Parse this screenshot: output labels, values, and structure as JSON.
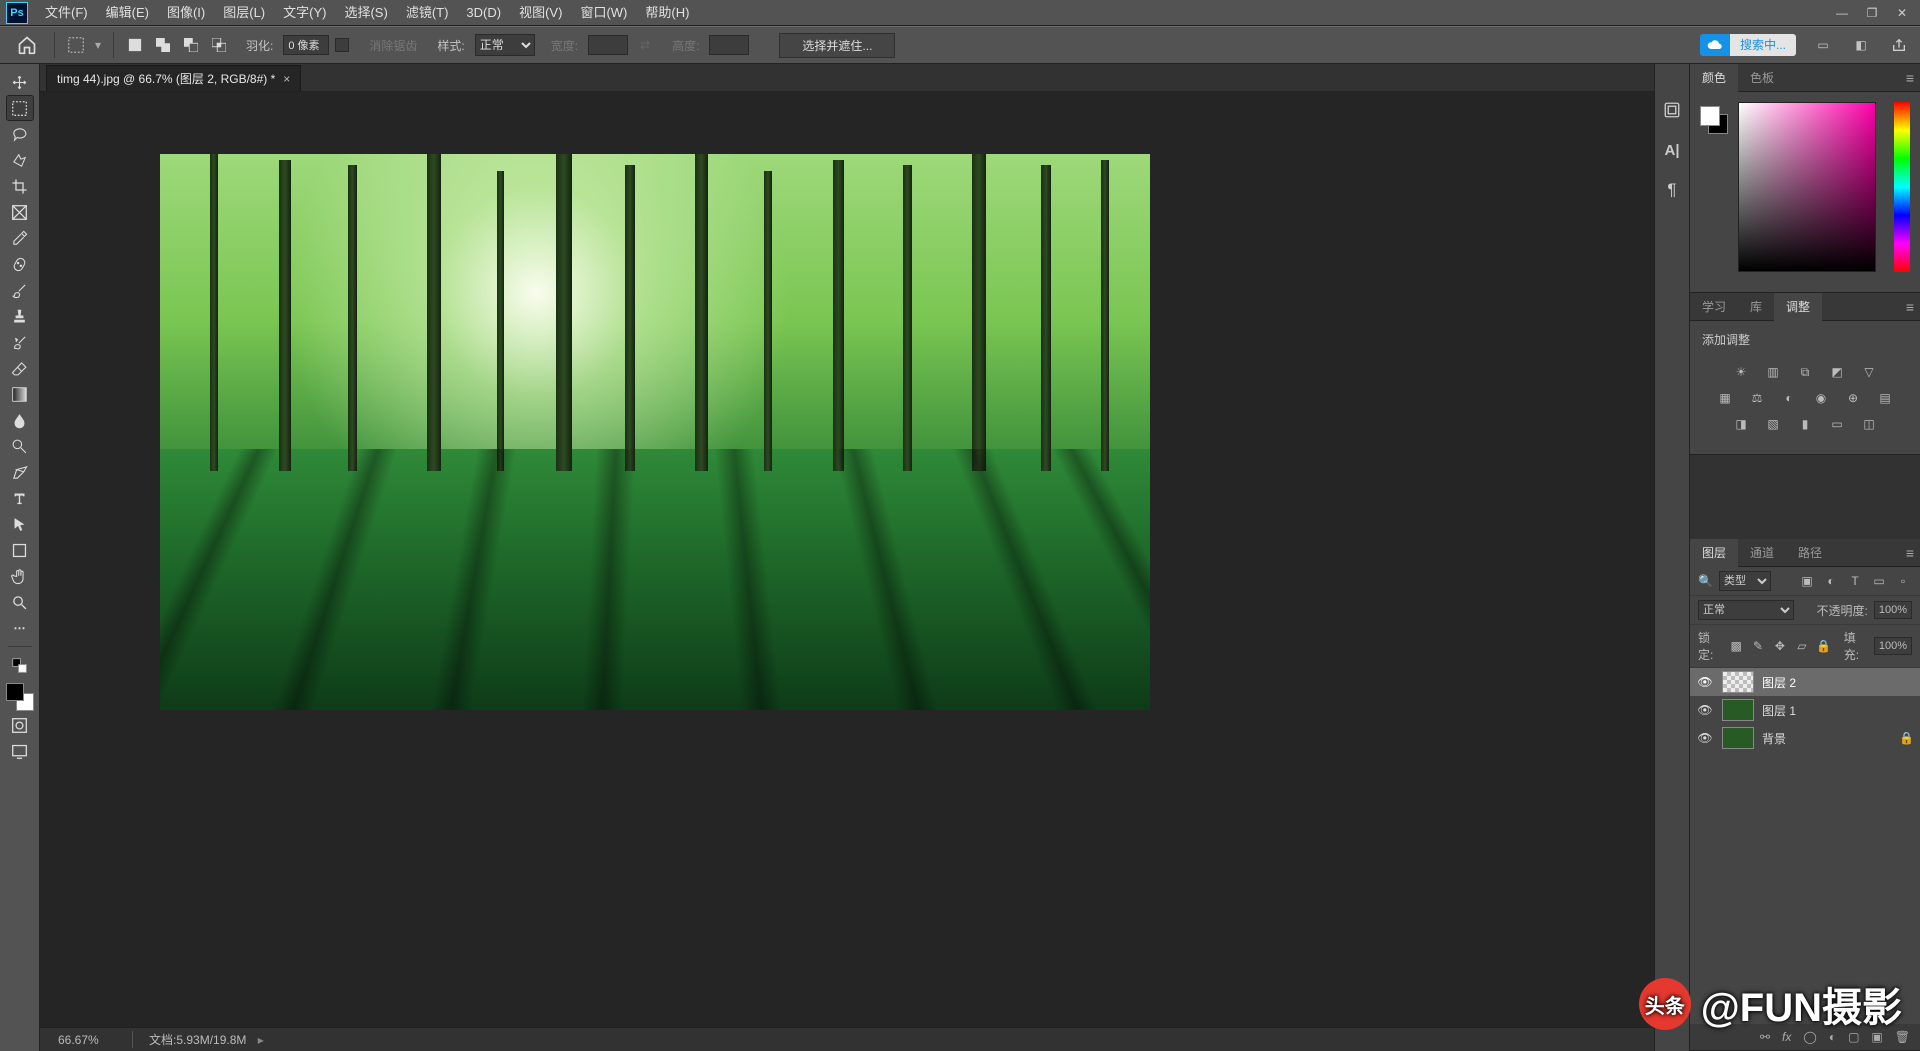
{
  "menu": {
    "items": [
      "文件(F)",
      "编辑(E)",
      "图像(I)",
      "图层(L)",
      "文字(Y)",
      "选择(S)",
      "滤镜(T)",
      "3D(D)",
      "视图(V)",
      "窗口(W)",
      "帮助(H)"
    ]
  },
  "options": {
    "feather_label": "羽化:",
    "feather_value": "0 像素",
    "antialias_label": "消除锯齿",
    "style_label": "样式:",
    "style_value": "正常",
    "width_label": "宽度:",
    "height_label": "高度:",
    "select_mask_btn": "选择并遮住...",
    "search_placeholder": "搜索中..."
  },
  "document": {
    "tab_title": "timg 44).jpg @ 66.7% (图层 2, RGB/8#) *",
    "zoom": "66.67%",
    "docsize_label": "文档:",
    "docsize_value": "5.93M/19.8M"
  },
  "panels": {
    "color_tabs": [
      "颜色",
      "色板"
    ],
    "adjust_tabs": [
      "学习",
      "库",
      "调整"
    ],
    "adjust_title": "添加调整",
    "layer_tabs": [
      "图层",
      "通道",
      "路径"
    ],
    "layer_filter_label": "类型",
    "blend_mode": "正常",
    "opacity_label": "不透明度:",
    "opacity_value": "100%",
    "lock_label": "锁定:",
    "fill_label": "填充:",
    "fill_value": "100%",
    "layers": [
      {
        "name": "图层 2",
        "thumb": "transparent",
        "selected": true,
        "locked": false
      },
      {
        "name": "图层 1",
        "thumb": "forest",
        "selected": false,
        "locked": false
      },
      {
        "name": "背景",
        "thumb": "forest",
        "selected": false,
        "locked": true
      }
    ]
  },
  "watermark": {
    "brand": "头条",
    "handle": "@FUN摄影"
  }
}
